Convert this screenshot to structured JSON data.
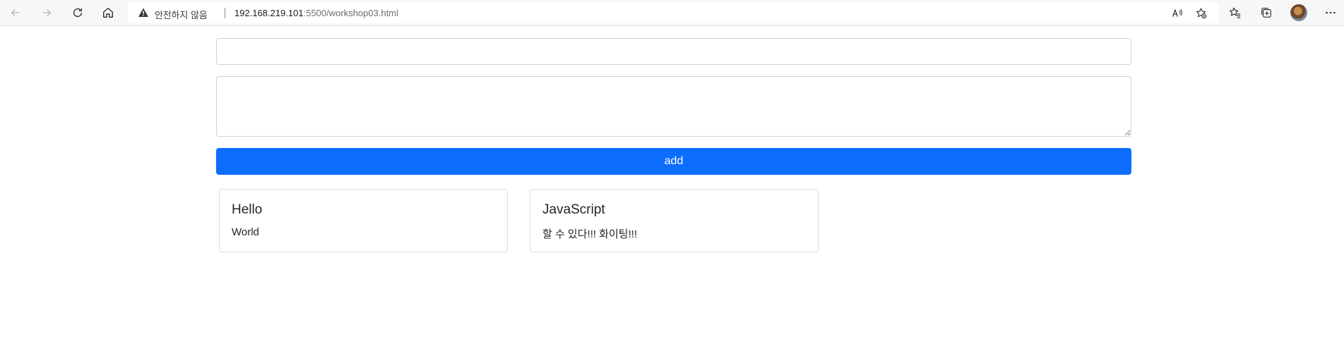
{
  "browser": {
    "security_text": "안전하지 않음",
    "url_host": "192.168.219.101",
    "url_rest": ":5500/workshop03.html",
    "icons": {
      "back": "back-arrow-icon",
      "forward": "forward-arrow-icon",
      "refresh": "refresh-icon",
      "home": "home-icon",
      "warning": "warning-icon",
      "read_aloud": "read-aloud-icon",
      "favorite_add": "add-favorite-icon",
      "favorites": "favorites-icon",
      "collections": "collections-icon",
      "profile": "profile-avatar",
      "more": "more-icon"
    }
  },
  "form": {
    "title_value": "",
    "content_value": "",
    "add_label": "add"
  },
  "colors": {
    "primary": "#0d6efd",
    "border": "#ced4da"
  },
  "cards": [
    {
      "title": "Hello",
      "body": "World"
    },
    {
      "title": "JavaScript",
      "body": "할 수 있다!!! 화이팅!!!"
    }
  ]
}
